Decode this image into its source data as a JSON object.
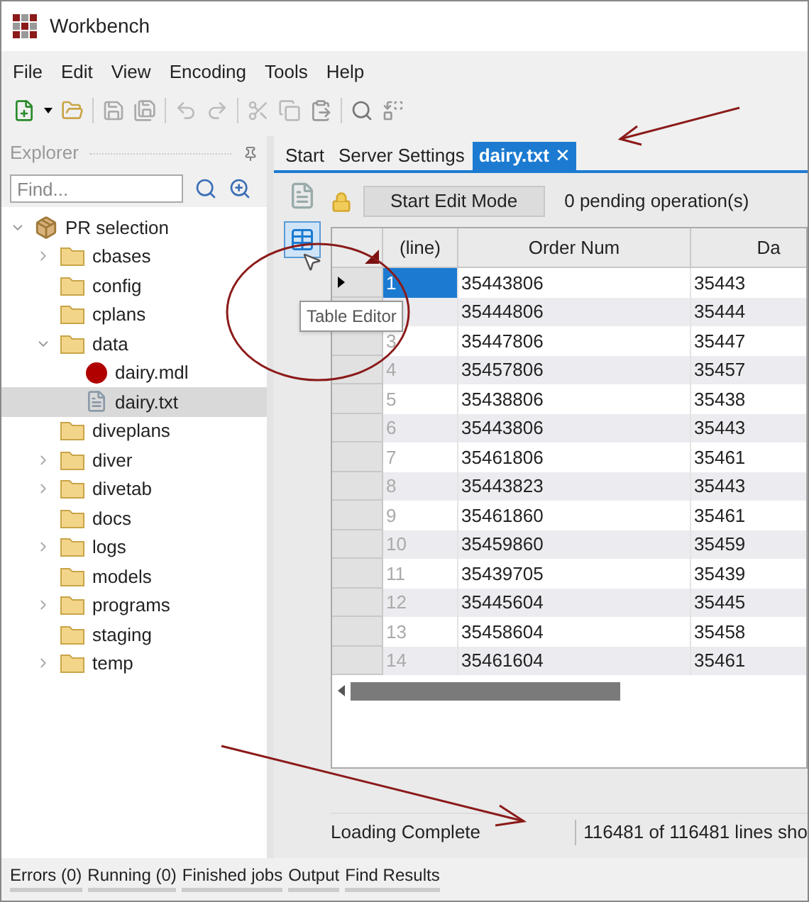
{
  "window": {
    "title": "Workbench"
  },
  "menu": [
    "File",
    "Edit",
    "View",
    "Encoding",
    "Tools",
    "Help"
  ],
  "explorer": {
    "title": "Explorer",
    "search": {
      "placeholder": "Find..."
    },
    "tree": [
      {
        "label": "PR selection",
        "kind": "project",
        "expanded": true,
        "selected": false,
        "children": [
          {
            "label": "cbases",
            "kind": "folder",
            "expanded": false,
            "selected": false
          },
          {
            "label": "config",
            "kind": "folder",
            "selected": false
          },
          {
            "label": "cplans",
            "kind": "folder",
            "selected": false
          },
          {
            "label": "data",
            "kind": "folder",
            "expanded": true,
            "selected": false,
            "children": [
              {
                "label": "dairy.mdl",
                "kind": "model",
                "selected": false
              },
              {
                "label": "dairy.txt",
                "kind": "file",
                "selected": true
              }
            ]
          },
          {
            "label": "diveplans",
            "kind": "folder",
            "selected": false
          },
          {
            "label": "diver",
            "kind": "folder",
            "expanded": false,
            "selected": false
          },
          {
            "label": "divetab",
            "kind": "folder",
            "expanded": false,
            "selected": false
          },
          {
            "label": "docs",
            "kind": "folder",
            "selected": false
          },
          {
            "label": "logs",
            "kind": "folder",
            "expanded": false,
            "selected": false
          },
          {
            "label": "models",
            "kind": "folder",
            "selected": false
          },
          {
            "label": "programs",
            "kind": "folder",
            "expanded": false,
            "selected": false
          },
          {
            "label": "staging",
            "kind": "folder",
            "selected": false
          },
          {
            "label": "temp",
            "kind": "folder",
            "expanded": false,
            "selected": false
          }
        ]
      }
    ]
  },
  "tabs": [
    {
      "label": "Start",
      "selected": false
    },
    {
      "label": "Server Settings",
      "selected": false
    },
    {
      "label": "dairy.txt",
      "selected": true,
      "close": "✕"
    }
  ],
  "tooltip": "Table Editor",
  "editor": {
    "button": "Start Edit Mode",
    "pending": "0 pending operation(s)"
  },
  "table": {
    "columns": [
      "(line)",
      "Order Num",
      "Da"
    ],
    "rows": [
      {
        "line": "1",
        "cells": [
          "35443806",
          "35443"
        ],
        "selected": true,
        "current": true
      },
      {
        "cells": [
          "35444806",
          "35444"
        ],
        "selected": false
      },
      {
        "line": "3",
        "cells": [
          "35447806",
          "35447"
        ],
        "selected": false,
        "current": false
      },
      {
        "line": "4",
        "cells": [
          "35457806",
          "35457"
        ],
        "selected": false,
        "current": false
      },
      {
        "line": "5",
        "cells": [
          "35438806",
          "35438"
        ],
        "selected": false,
        "current": false
      },
      {
        "line": "6",
        "cells": [
          "35443806",
          "35443"
        ],
        "selected": false,
        "current": false
      },
      {
        "line": "7",
        "cells": [
          "35461806",
          "35461"
        ],
        "selected": false,
        "current": false
      },
      {
        "line": "8",
        "cells": [
          "35443823",
          "35443"
        ],
        "selected": false,
        "current": false
      },
      {
        "line": "9",
        "cells": [
          "35461860",
          "35461"
        ],
        "selected": false,
        "current": false
      },
      {
        "line": "10",
        "cells": [
          "35459860",
          "35459"
        ],
        "selected": false,
        "current": false
      },
      {
        "line": "11",
        "cells": [
          "35439705",
          "35439"
        ],
        "selected": false,
        "current": false
      },
      {
        "line": "12",
        "cells": [
          "35445604",
          "35445"
        ],
        "selected": false,
        "current": false
      },
      {
        "line": "13",
        "cells": [
          "35458604",
          "35458"
        ],
        "selected": false,
        "current": false
      },
      {
        "line": "14",
        "cells": [
          "35461604",
          "35461"
        ],
        "selected": false,
        "current": false
      }
    ]
  },
  "status_bar": [
    "Loading Complete",
    "116481 of 116481 lines sho"
  ],
  "bottom_tabs": [
    "Errors (0)",
    "Running (0)",
    "Finished jobs",
    "Output",
    "Find Results"
  ]
}
